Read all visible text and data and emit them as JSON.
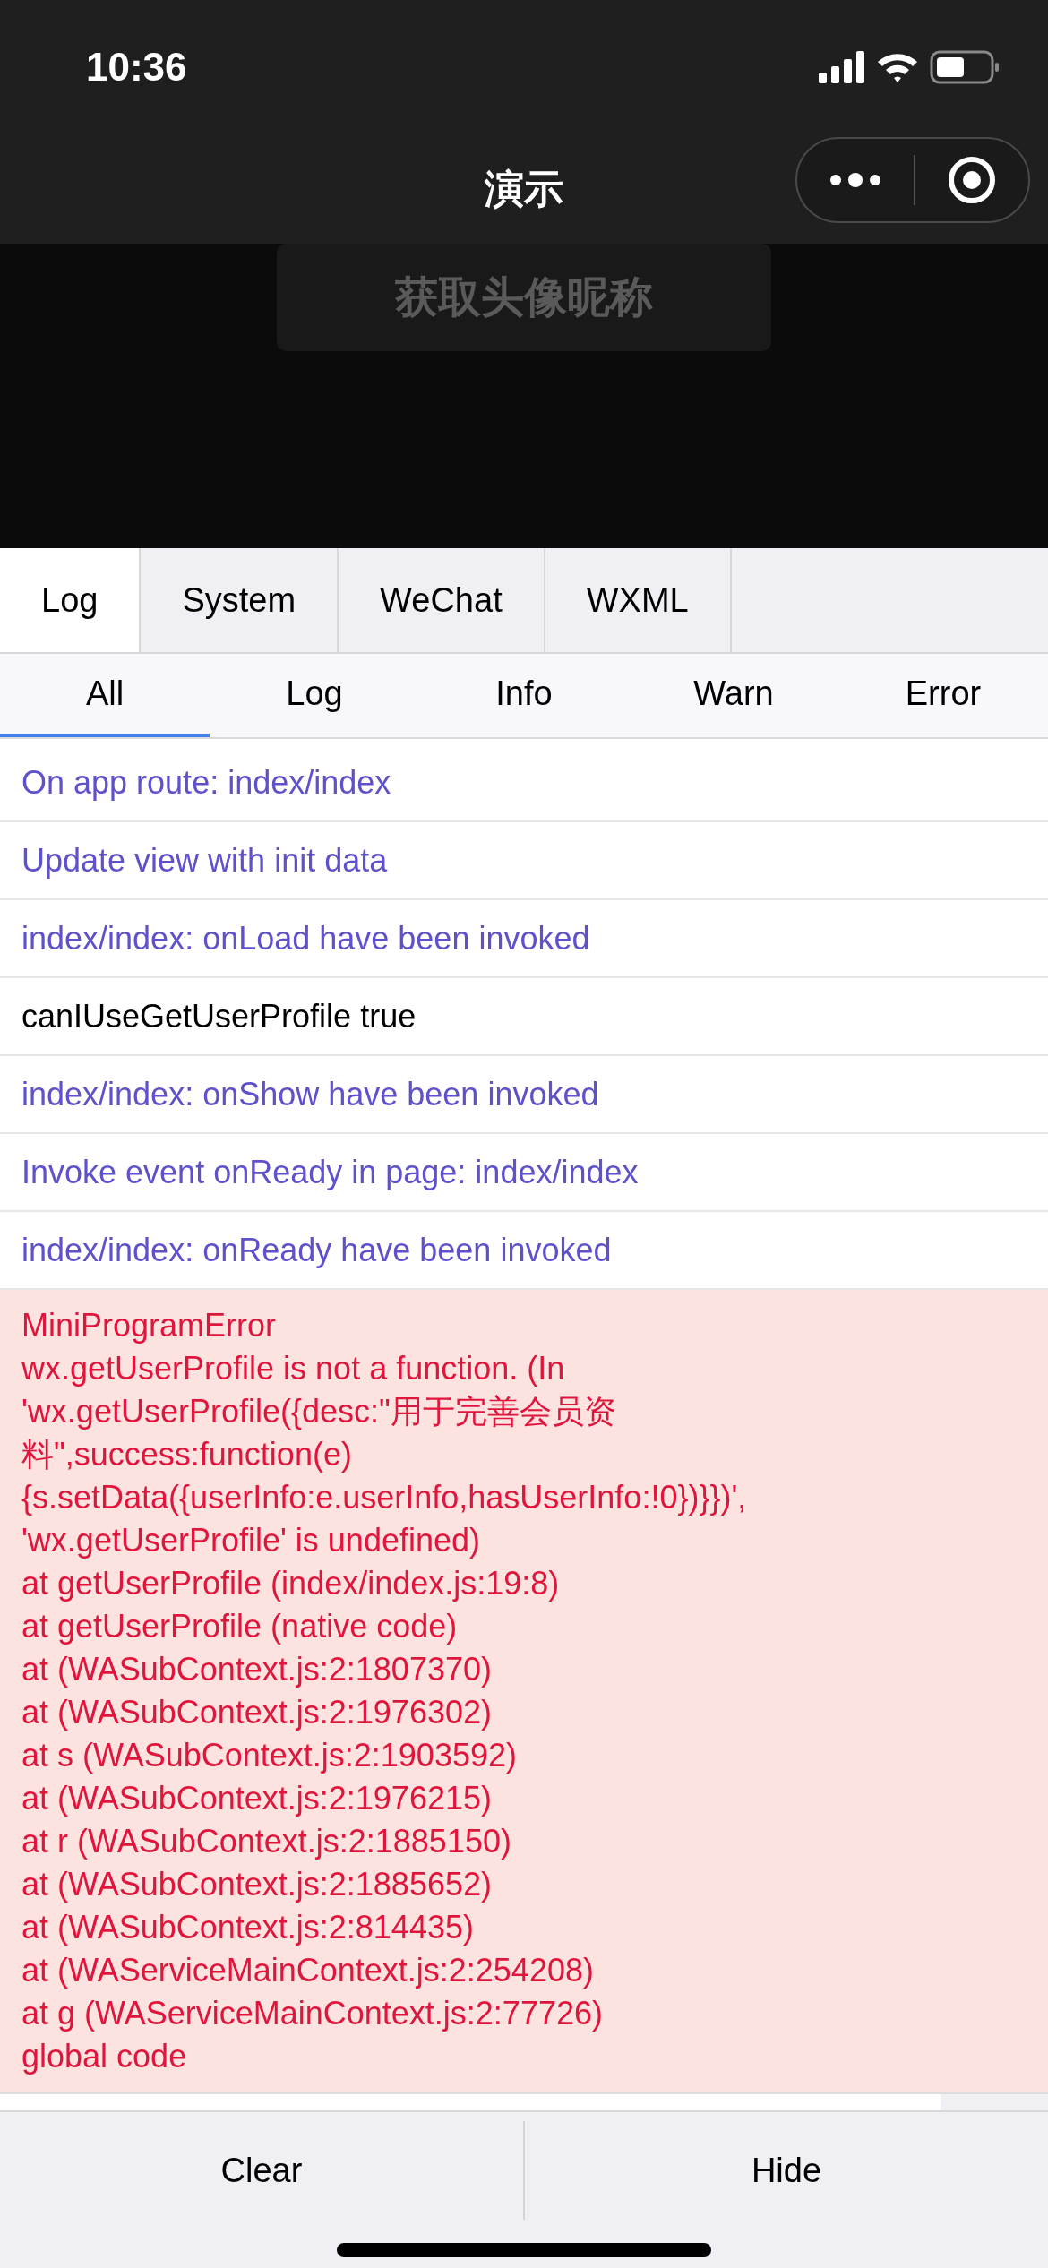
{
  "status_bar": {
    "time": "10:36"
  },
  "nav_bar": {
    "title": "演示"
  },
  "page": {
    "button": "获取头像昵称"
  },
  "tabs": [
    {
      "label": "Log",
      "selected": true
    },
    {
      "label": "System",
      "selected": false
    },
    {
      "label": "WeChat",
      "selected": false
    },
    {
      "label": "WXML",
      "selected": false
    }
  ],
  "filters": [
    {
      "label": "All",
      "selected": true
    },
    {
      "label": "Log",
      "selected": false
    },
    {
      "label": "Info",
      "selected": false
    },
    {
      "label": "Warn",
      "selected": false
    },
    {
      "label": "Error",
      "selected": false
    }
  ],
  "entries": [
    {
      "kind": "info",
      "text": "On app route: index/index"
    },
    {
      "kind": "info",
      "text": "Update view with init data"
    },
    {
      "kind": "info",
      "text": "index/index: onLoad have been invoked"
    },
    {
      "kind": "log",
      "text": "canIUseGetUserProfile true"
    },
    {
      "kind": "info",
      "text": "index/index: onShow have been invoked"
    },
    {
      "kind": "info",
      "text": "Invoke event onReady in page: index/index"
    },
    {
      "kind": "info",
      "text": "index/index: onReady have been invoked"
    },
    {
      "kind": "error",
      "lines": [
        "MiniProgramError",
        "wx.getUserProfile is not a function. (In",
        "'wx.getUserProfile({desc:\"用于完善会员资",
        "料\",success:function(e)",
        "{s.setData({userInfo:e.userInfo,hasUserInfo:!0})}})',",
        "'wx.getUserProfile' is undefined)",
        "at getUserProfile (index/index.js:19:8)",
        "at getUserProfile (native code)",
        "at (WASubContext.js:2:1807370)",
        "at (WASubContext.js:2:1976302)",
        "at s (WASubContext.js:2:1903592)",
        "at (WASubContext.js:2:1976215)",
        "at r (WASubContext.js:2:1885150)",
        "at (WASubContext.js:2:1885652)",
        "at (WASubContext.js:2:814435)",
        "at (WAServiceMainContext.js:2:254208)",
        "at g (WAServiceMainContext.js:2:77726)",
        "global code"
      ]
    }
  ],
  "footer_buttons": [
    "Clear",
    "Hide"
  ]
}
